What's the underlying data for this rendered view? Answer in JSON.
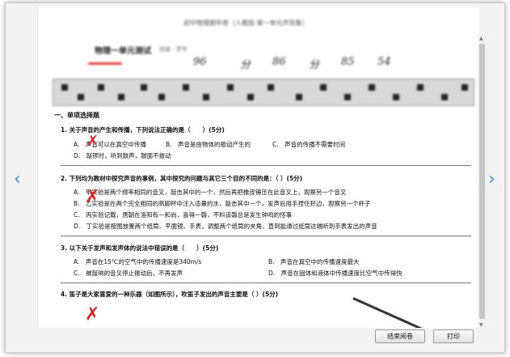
{
  "header": {
    "doc_title": "初中物理期中卷（人教版·第一单元声现象）",
    "quiz_title": "物理一单元测试",
    "quiz_sub": "班级 · 学号",
    "score_marks": [
      "96",
      "分",
      "86",
      "分",
      "85",
      "54"
    ]
  },
  "section": {
    "heading": "一、单项选择题"
  },
  "questions": [
    {
      "stem": "1. 关于声音的产生和传播，下列说法正确的是（　　）(5分)",
      "options": {
        "a": "A.　声音可以在真空中传播",
        "b": "B.　声音是由物体的振动产生的",
        "c": "C.　声音的传播不需要时间",
        "d": "D.　敲锣时，听到鼓声，鼓面不振动"
      }
    },
    {
      "stem": "2. 下列均为教材中探究声音的事例，其中探究的问题与其它三个目的不同的是：（ ）(5分)",
      "options": {
        "a": "A.　甲实验是两个频率相同的音叉，敲击其中的一个，然后再把橡皮锤压在此音叉上，观察另一个音叉",
        "b": "B.　乙实验是在两个完全相同的高脚杯中注入适量的水，敲击其中一个，发声后用手捏住杯边，观察另一个杯子",
        "c": "C.　丙实验记载，唐朝在洛阳有一和尚，喜得一磬，不料该磬总是发生钟鸣的怪事",
        "d": "D.　丁实验是按图放置两个纸筒、平面镜、手表，调整两个纸筒的夹角，直到能通过纸筒这端听到手表发出的声音"
      }
    },
    {
      "stem": "3. 以下关于发声和发声体的说法中错误的是（　　）(5分)",
      "options": {
        "a": "A.　声音在15℃的空气中的传播速度是340m/s",
        "b": "B.　声音在真空中的传播速度最大",
        "c": "C.　被敲响的音叉停止振动后，不再发声",
        "d": "D.　声音在固体和液体中传播速度比空气中传得快"
      }
    },
    {
      "stem": "4. 笛子是大家喜爱的一种乐器（如图所示），吹笛子发出的声音主要是（ ）(5分)"
    }
  ],
  "nav": {
    "prev": "‹",
    "next": "›"
  },
  "buttons": {
    "finish": "结束阅卷",
    "print": "打印"
  },
  "colors": {
    "accent": "#3a8ee6",
    "mark": "#e02020"
  }
}
